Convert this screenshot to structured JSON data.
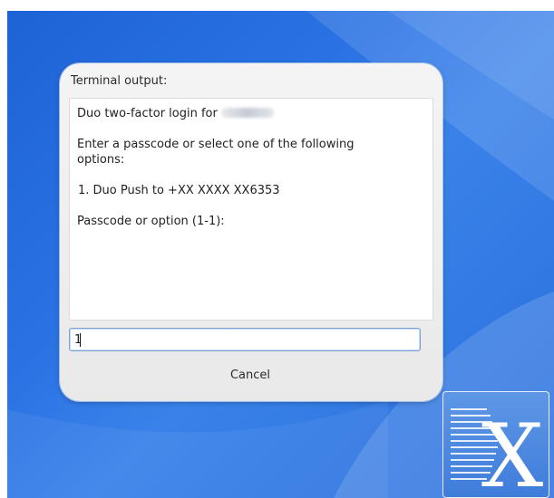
{
  "dialog": {
    "title": "Terminal output:",
    "output_lines": [
      "Duo two-factor login for",
      "Enter a passcode or select one of the following",
      "options:",
      " 1. Duo Push to +XX XXXX XX6353",
      "Passcode or option (1-1):"
    ],
    "input_value": "1",
    "cancel_label": "Cancel"
  },
  "logo": {
    "letter": "X"
  },
  "colors": {
    "desktop_blue": "#2a72e3",
    "dialog_bg": "#eeeeee",
    "input_border": "#7aa2d8"
  }
}
